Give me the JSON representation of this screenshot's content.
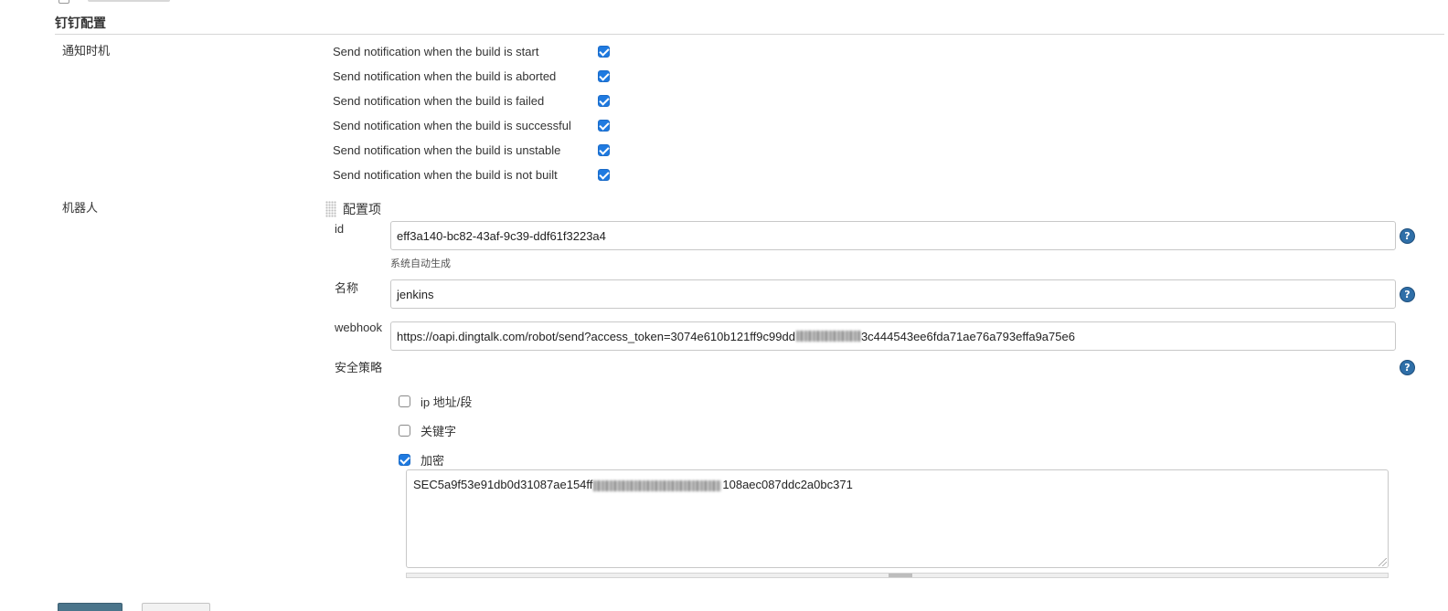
{
  "section": {
    "title": "钉钉配置"
  },
  "notify": {
    "label": "通知时机",
    "items": [
      {
        "label": "Send notification when the build is start",
        "checked": true
      },
      {
        "label": "Send notification when the build is aborted",
        "checked": true
      },
      {
        "label": "Send notification when the build is failed",
        "checked": true
      },
      {
        "label": "Send notification when the build is successful",
        "checked": true
      },
      {
        "label": "Send notification when the build is unstable",
        "checked": true
      },
      {
        "label": "Send notification when the build is not built",
        "checked": true
      }
    ]
  },
  "robot": {
    "label": "机器人",
    "config_item_label": "配置项",
    "id": {
      "label": "id",
      "value": "eff3a140-bc82-43af-9c39-ddf61f3223a4",
      "hint": "系统自动生成"
    },
    "name": {
      "label": "名称",
      "value": "jenkins"
    },
    "webhook": {
      "label": "webhook",
      "value_prefix": "https://oapi.dingtalk.com/robot/send?access_token=3074e610b121ff9c99dd",
      "value_suffix": "3c444543ee6fda71ae76a793effa9a75e6"
    },
    "security": {
      "label": "安全策略",
      "options": [
        {
          "label": "ip 地址/段",
          "checked": false
        },
        {
          "label": "关键字",
          "checked": false
        },
        {
          "label": "加密",
          "checked": true
        }
      ],
      "secret_prefix": "SEC5a9f53e91db0d31087ae154ff",
      "secret_suffix": "108aec087ddc2a0bc371"
    }
  },
  "help_icon_glyph": "?",
  "colors": {
    "checkbox_checked": "#1f7ae0",
    "help_icon": "#2f6fa8",
    "primary_button": "#4b758b"
  }
}
